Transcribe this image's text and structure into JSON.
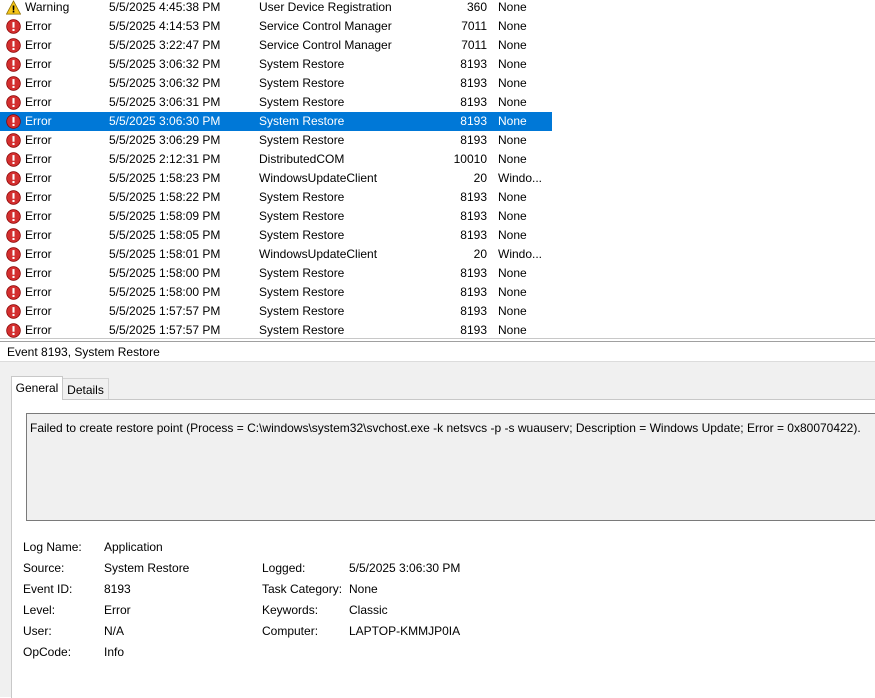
{
  "event_list": {
    "rows": [
      {
        "level": "Warning",
        "icon": "warning-icon",
        "datetime": "5/5/2025 4:45:38 PM",
        "source": "User Device Registration",
        "event_id": "360",
        "task_category": "None"
      },
      {
        "level": "Error",
        "icon": "error-icon",
        "datetime": "5/5/2025 4:14:53 PM",
        "source": "Service Control Manager",
        "event_id": "7011",
        "task_category": "None"
      },
      {
        "level": "Error",
        "icon": "error-icon",
        "datetime": "5/5/2025 3:22:47 PM",
        "source": "Service Control Manager",
        "event_id": "7011",
        "task_category": "None"
      },
      {
        "level": "Error",
        "icon": "error-icon",
        "datetime": "5/5/2025 3:06:32 PM",
        "source": "System Restore",
        "event_id": "8193",
        "task_category": "None"
      },
      {
        "level": "Error",
        "icon": "error-icon",
        "datetime": "5/5/2025 3:06:32 PM",
        "source": "System Restore",
        "event_id": "8193",
        "task_category": "None"
      },
      {
        "level": "Error",
        "icon": "error-icon",
        "datetime": "5/5/2025 3:06:31 PM",
        "source": "System Restore",
        "event_id": "8193",
        "task_category": "None"
      },
      {
        "level": "Error",
        "icon": "error-icon",
        "datetime": "5/5/2025 3:06:30 PM",
        "source": "System Restore",
        "event_id": "8193",
        "task_category": "None",
        "selected": true
      },
      {
        "level": "Error",
        "icon": "error-icon",
        "datetime": "5/5/2025 3:06:29 PM",
        "source": "System Restore",
        "event_id": "8193",
        "task_category": "None"
      },
      {
        "level": "Error",
        "icon": "error-icon",
        "datetime": "5/5/2025 2:12:31 PM",
        "source": "DistributedCOM",
        "event_id": "10010",
        "task_category": "None"
      },
      {
        "level": "Error",
        "icon": "error-icon",
        "datetime": "5/5/2025 1:58:23 PM",
        "source": "WindowsUpdateClient",
        "event_id": "20",
        "task_category": "Windo..."
      },
      {
        "level": "Error",
        "icon": "error-icon",
        "datetime": "5/5/2025 1:58:22 PM",
        "source": "System Restore",
        "event_id": "8193",
        "task_category": "None"
      },
      {
        "level": "Error",
        "icon": "error-icon",
        "datetime": "5/5/2025 1:58:09 PM",
        "source": "System Restore",
        "event_id": "8193",
        "task_category": "None"
      },
      {
        "level": "Error",
        "icon": "error-icon",
        "datetime": "5/5/2025 1:58:05 PM",
        "source": "System Restore",
        "event_id": "8193",
        "task_category": "None"
      },
      {
        "level": "Error",
        "icon": "error-icon",
        "datetime": "5/5/2025 1:58:01 PM",
        "source": "WindowsUpdateClient",
        "event_id": "20",
        "task_category": "Windo..."
      },
      {
        "level": "Error",
        "icon": "error-icon",
        "datetime": "5/5/2025 1:58:00 PM",
        "source": "System Restore",
        "event_id": "8193",
        "task_category": "None"
      },
      {
        "level": "Error",
        "icon": "error-icon",
        "datetime": "5/5/2025 1:58:00 PM",
        "source": "System Restore",
        "event_id": "8193",
        "task_category": "None"
      },
      {
        "level": "Error",
        "icon": "error-icon",
        "datetime": "5/5/2025 1:57:57 PM",
        "source": "System Restore",
        "event_id": "8193",
        "task_category": "None"
      },
      {
        "level": "Error",
        "icon": "error-icon",
        "datetime": "5/5/2025 1:57:57 PM",
        "source": "System Restore",
        "event_id": "8193",
        "task_category": "None"
      }
    ]
  },
  "details": {
    "title": "Event 8193, System Restore",
    "tabs": [
      {
        "label": "General",
        "active": true
      },
      {
        "label": "Details",
        "active": false
      }
    ],
    "message": "Failed to create restore point (Process = C:\\windows\\system32\\svchost.exe -k netsvcs -p -s wuauserv; Description = Windows Update; Error = 0x80070422).",
    "properties": {
      "log_name_label": "Log Name:",
      "log_name": "Application",
      "source_label": "Source:",
      "source": "System Restore",
      "logged_label": "Logged:",
      "logged": "5/5/2025 3:06:30 PM",
      "event_id_label": "Event ID:",
      "event_id": "8193",
      "task_category_label": "Task Category:",
      "task_category": "None",
      "level_label": "Level:",
      "level": "Error",
      "keywords_label": "Keywords:",
      "keywords": "Classic",
      "user_label": "User:",
      "user": "N/A",
      "computer_label": "Computer:",
      "computer": "LAPTOP-KMMJP0IA",
      "opcode_label": "OpCode:",
      "opcode": "Info"
    }
  },
  "colors": {
    "selection": "#0078d7",
    "error_icon": "#d32f2f",
    "warning_icon": "#f5c518",
    "panel_bg": "#f0f0f0"
  }
}
